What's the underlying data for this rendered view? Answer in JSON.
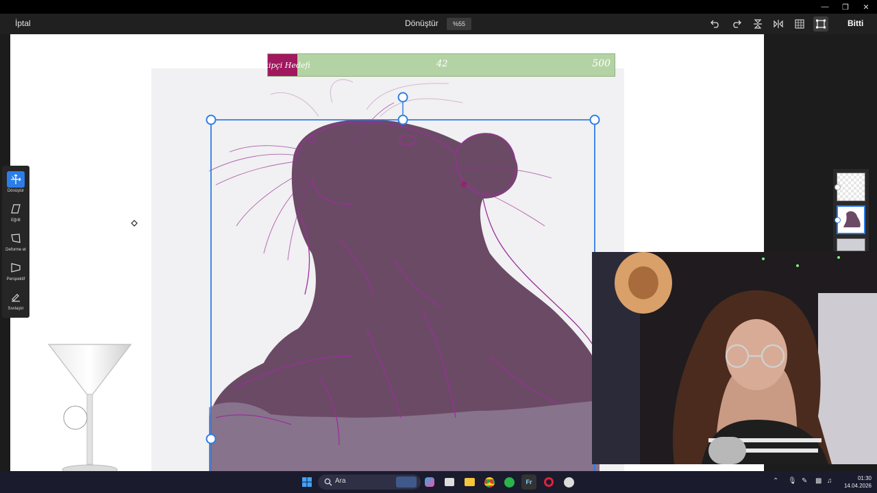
{
  "toolbar": {
    "cancel_label": "İptal",
    "title": "Dönüştür",
    "zoom": "%55",
    "done_label": "Bitti"
  },
  "goal_widget": {
    "label": "Takipçi Hedefi",
    "current": "42",
    "target": "500",
    "progress_fraction": 0.084
  },
  "side_tools": [
    {
      "label": "Dönüştür",
      "icon": "move-arrows-icon",
      "active": true
    },
    {
      "label": "Eğrilt",
      "icon": "skew-icon",
      "active": false
    },
    {
      "label": "Deforme et",
      "icon": "distort-icon",
      "active": false
    },
    {
      "label": "Perspektif",
      "icon": "perspective-icon",
      "active": false
    },
    {
      "label": "Sıvılaştır",
      "icon": "liquify-icon",
      "active": false
    }
  ],
  "taskbar": {
    "search_placeholder": "Ara",
    "time": "01:30",
    "date": "14.04.2026"
  },
  "colors": {
    "accent": "#2b7de9",
    "goal_bar": "#b4d3a5",
    "goal_label_bg": "#a0185e",
    "rat_fill": "#6b4a66",
    "sketch_line": "#9a2f9a"
  }
}
